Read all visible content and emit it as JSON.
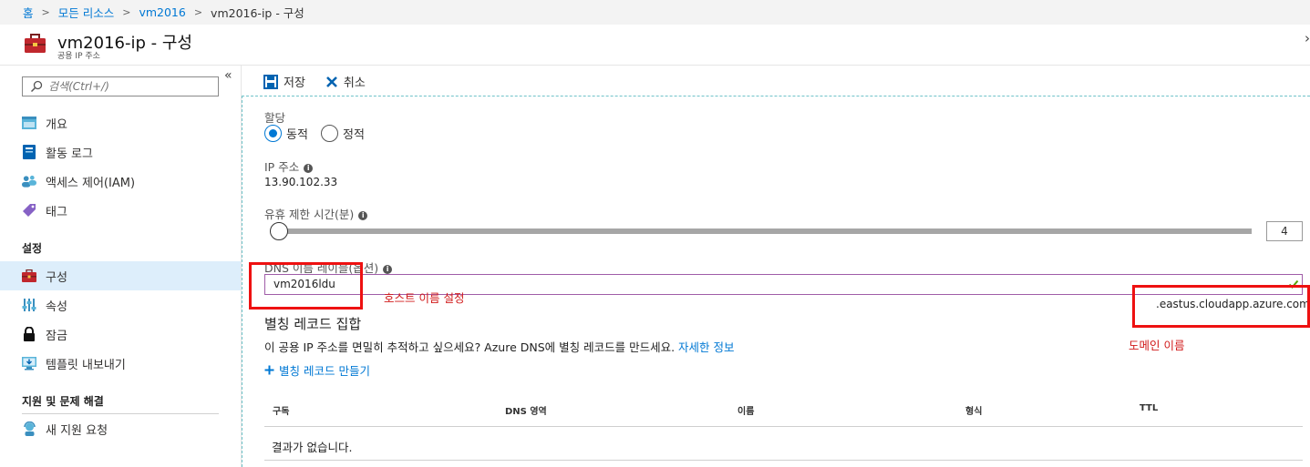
{
  "breadcrumb": {
    "items": [
      "홈",
      "모든 리소스",
      "vm2016"
    ],
    "current": "vm2016-ip - 구성",
    "separator": ">"
  },
  "header": {
    "title": "vm2016-ip - 구성",
    "subtitle": "공용 IP 주소",
    "close_glyph": "›"
  },
  "sidebar": {
    "collapse_glyph": "«",
    "search_placeholder": "검색(Ctrl+/)",
    "items": [
      {
        "label": "개요",
        "icon": "overview-icon"
      },
      {
        "label": "활동 로그",
        "icon": "activity-log-icon"
      },
      {
        "label": "액세스 제어(IAM)",
        "icon": "iam-icon"
      },
      {
        "label": "태그",
        "icon": "tag-icon"
      }
    ],
    "section_settings": "설정",
    "settings_items": [
      {
        "label": "구성",
        "icon": "toolbox-icon",
        "active": true
      },
      {
        "label": "속성",
        "icon": "properties-icon"
      },
      {
        "label": "잠금",
        "icon": "lock-icon"
      },
      {
        "label": "템플릿 내보내기",
        "icon": "export-template-icon"
      }
    ],
    "section_support": "지원 및 문제 해결",
    "support_items": [
      {
        "label": "새 지원 요청",
        "icon": "support-icon"
      }
    ]
  },
  "toolbar": {
    "save_label": "저장",
    "cancel_label": "취소"
  },
  "form": {
    "assignment_label": "할당",
    "radio_dynamic": "동적",
    "radio_static": "정적",
    "assignment_selected": "동적",
    "ip_label": "IP 주소",
    "ip_value": "13.90.102.33",
    "idle_label": "유휴 제한 시간(분)",
    "idle_value": "4",
    "idle_min": 4,
    "idle_max": 30,
    "dns_label": "DNS 이름 레이블(옵션)",
    "dns_value": "vm2016ldu",
    "dns_suffix": ".eastus.cloudapp.azure.com"
  },
  "annotations": {
    "host_label": "호스트 이름 설정",
    "domain_label": "도메인 이름",
    "color": "#ee1111"
  },
  "alias": {
    "title": "별칭 레코드 집합",
    "description": "이 공용 IP 주소를 면밀히 추적하고 싶으세요? Azure DNS에 별칭 레코드를 만드세요.",
    "more_link": "자세한 정보",
    "add_label": "별칭 레코드 만들기",
    "columns": [
      "구독",
      "DNS 영역",
      "이름",
      "형식",
      "TTL"
    ],
    "empty_text": "결과가 없습니다."
  },
  "colors": {
    "accent": "#0078d4",
    "active_nav": "#ddeefb"
  }
}
